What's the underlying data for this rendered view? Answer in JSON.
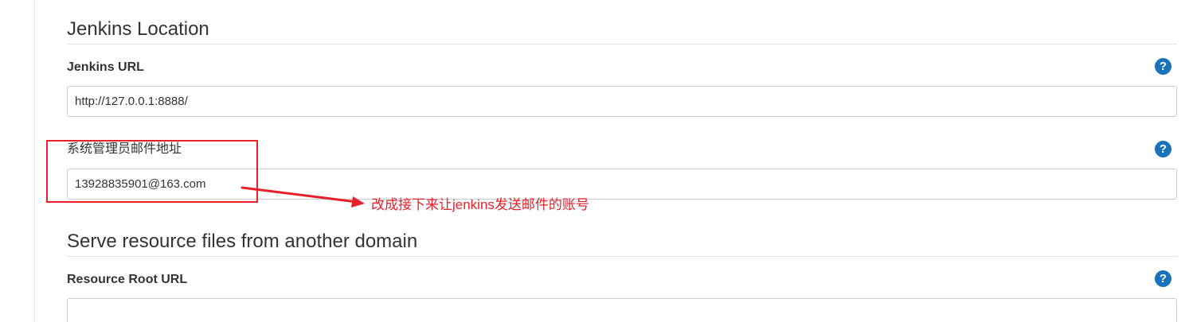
{
  "jenkins_location": {
    "title": "Jenkins Location",
    "jenkins_url": {
      "label": "Jenkins URL",
      "value": "http://127.0.0.1:8888/",
      "help": "?"
    },
    "admin_email": {
      "label": "系统管理员邮件地址",
      "value": "13928835901@163.com",
      "help": "?"
    }
  },
  "resource_root": {
    "title": "Serve resource files from another domain",
    "resource_root_url": {
      "label": "Resource Root URL",
      "value": "",
      "help": "?"
    }
  },
  "annotation": {
    "text": "改成接下来让jenkins发送邮件的账号",
    "color": "#e8202a"
  },
  "colors": {
    "help_icon": "#1a73b8",
    "annotation": "#e8202a"
  },
  "icons": {
    "help": "question-circle-icon",
    "arrow": "arrow-right-icon"
  }
}
